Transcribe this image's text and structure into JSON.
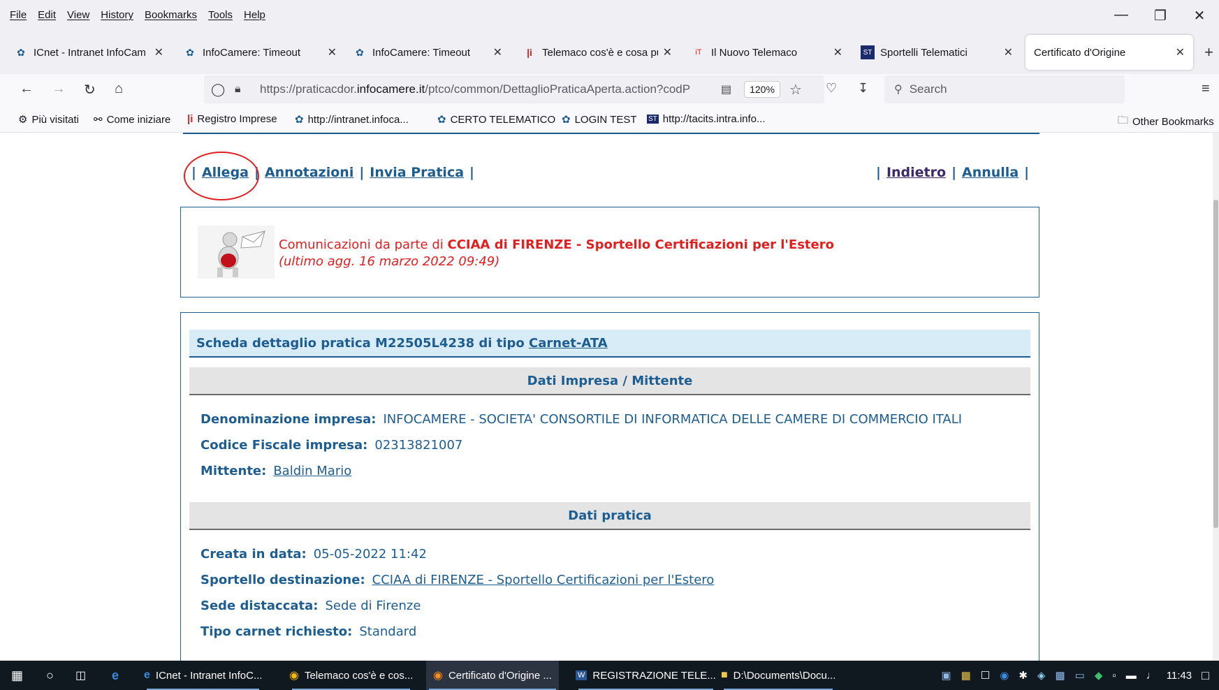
{
  "menubar": {
    "items": [
      "File",
      "Edit",
      "View",
      "History",
      "Bookmarks",
      "Tools",
      "Help"
    ],
    "window_controls": [
      "minimize-icon",
      "restore-icon",
      "close-icon"
    ]
  },
  "tabs": [
    {
      "title": "ICnet - Intranet InfoCam",
      "icon": "infocamere-icon"
    },
    {
      "title": "InfoCamere: Timeout",
      "icon": "infocamere-icon"
    },
    {
      "title": "InfoCamere: Timeout",
      "icon": "infocamere-icon"
    },
    {
      "title": "Telemaco cos'è e cosa pu",
      "icon": "telemaco-icon"
    },
    {
      "title": "Il Nuovo Telemaco",
      "icon": "telemaco-icon"
    },
    {
      "title": "Sportelli Telematici",
      "icon": "sportelli-icon"
    },
    {
      "title": "Certificato d'Origine",
      "icon": "page-icon",
      "active": true
    }
  ],
  "navbar": {
    "url_prefix": "https://praticacdor.",
    "url_domain": "infocamere.it",
    "url_path": "/ptco/common/DettaglioPraticaAperta.action?codP",
    "zoom": "120%",
    "search_placeholder": "Search"
  },
  "bookmarks": [
    {
      "label": "Più visitati",
      "icon": "gear-icon"
    },
    {
      "label": "Come iniziare",
      "icon": "globe-icon"
    },
    {
      "label": "Registro Imprese",
      "icon": "telemaco-icon"
    },
    {
      "label": "http://intranet.infoca...",
      "icon": "infocamere-icon"
    },
    {
      "label": "CERTO TELEMATICO",
      "icon": "infocamere-icon"
    },
    {
      "label": "LOGIN TEST",
      "icon": "infocamere-icon"
    },
    {
      "label": "http://tacits.intra.info...",
      "icon": "sportelli-icon"
    }
  ],
  "other_bookmarks": "Other Bookmarks",
  "page": {
    "links_left": [
      "Allega",
      "Annotazioni",
      "Invia Pratica"
    ],
    "links_right": [
      "Indietro",
      "Annulla"
    ],
    "communication": {
      "prefix": "Comunicazioni da parte di ",
      "sender": "CCIAA di FIRENZE - Sportello Certificazioni per l'Estero",
      "updated": "(ultimo agg. 16 marzo 2022 09:49)"
    },
    "detail_title_prefix": "Scheda dettaglio pratica M22505L4238 di tipo ",
    "detail_type": "Carnet-ATA",
    "sections": {
      "impresa": "Dati Impresa / Mittente",
      "pratica": "Dati pratica"
    },
    "fields": {
      "denominazione_label": "Denominazione impresa:",
      "denominazione_value": "INFOCAMERE - SOCIETA' CONSORTILE DI INFORMATICA DELLE CAMERE DI COMMERCIO ITALI",
      "codice_label": "Codice Fiscale impresa:",
      "codice_value": "02313821007",
      "mittente_label": "Mittente:",
      "mittente_value": "Baldin Mario",
      "creata_label": "Creata in data:",
      "creata_value": "05-05-2022 11:42",
      "sportello_label": "Sportello destinazione:",
      "sportello_value": "CCIAA di FIRENZE - Sportello Certificazioni per l'Estero",
      "sede_label": "Sede distaccata:",
      "sede_value": "Sede di Firenze",
      "tipo_label": "Tipo carnet richiesto:",
      "tipo_value": "Standard"
    }
  },
  "taskbar": {
    "apps": [
      {
        "label": "ICnet - Intranet InfoC...",
        "icon": "edge-icon"
      },
      {
        "label": "Telemaco cos'è e cos...",
        "icon": "chrome-icon"
      },
      {
        "label": "Certificato d'Origine ...",
        "icon": "firefox-icon"
      },
      {
        "label": "REGISTRAZIONE TELE...",
        "icon": "word-icon"
      },
      {
        "label": "D:\\Documents\\Docu...",
        "icon": "folder-icon"
      }
    ],
    "time": "11:43"
  },
  "colors": {
    "link_blue": "#1d5d90",
    "alert_red": "#e02020",
    "header_bg": "#d8ecf8",
    "section_bg": "#e4e4e4"
  }
}
